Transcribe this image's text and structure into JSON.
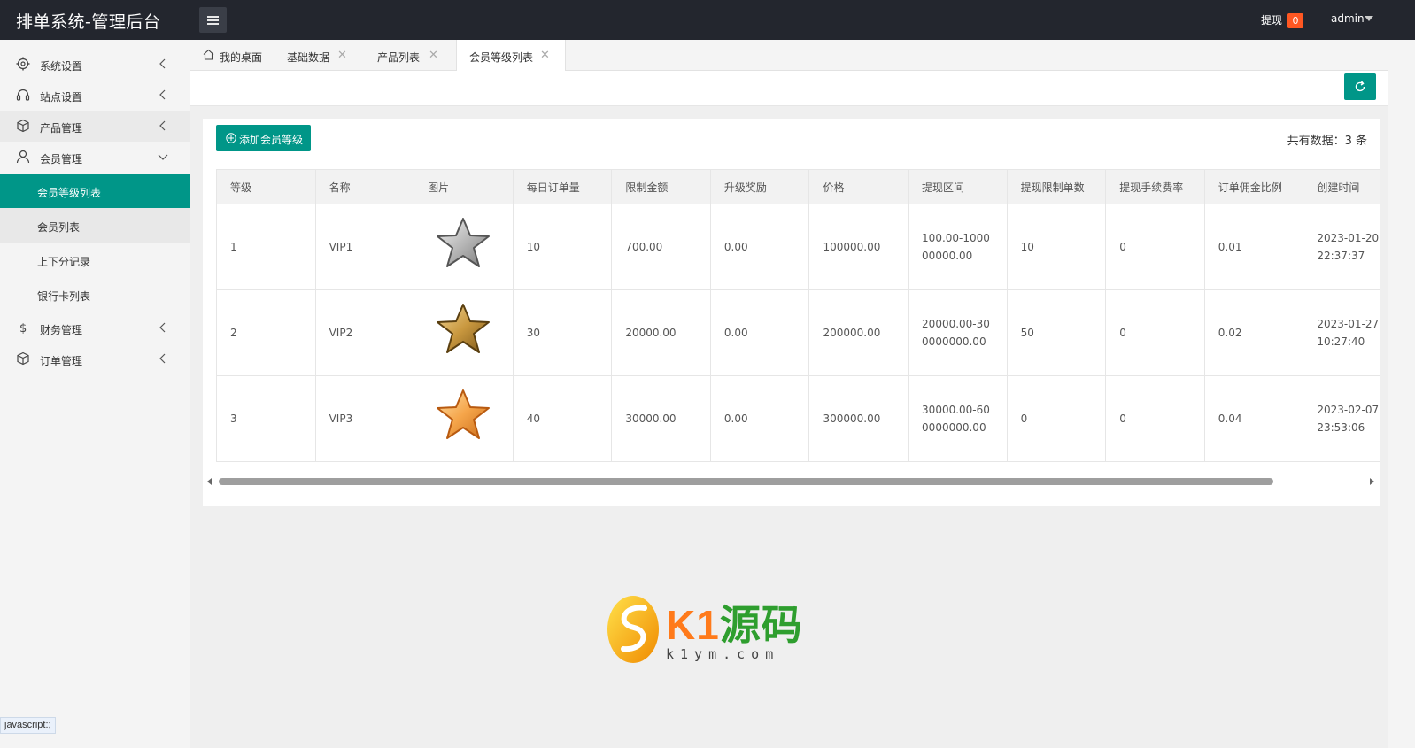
{
  "app": {
    "title": "排单系统-管理后台"
  },
  "header": {
    "withdraw_label": "提现",
    "withdraw_count": "0",
    "user": "admin"
  },
  "sidebar": {
    "groups": [
      {
        "label": "系统设置",
        "icon": "gear-icon"
      },
      {
        "label": "站点设置",
        "icon": "headset-icon"
      },
      {
        "label": "产品管理",
        "icon": "cube-icon"
      },
      {
        "label": "会员管理",
        "icon": "user-icon"
      },
      {
        "label": "财务管理",
        "icon": "dollar-icon"
      },
      {
        "label": "订单管理",
        "icon": "cube-icon"
      }
    ],
    "sub_items": [
      "会员等级列表",
      "会员列表",
      "上下分记录",
      "银行卡列表"
    ]
  },
  "tabs": [
    {
      "label": "我的桌面"
    },
    {
      "label": "基础数据"
    },
    {
      "label": "产品列表"
    },
    {
      "label": "会员等级列表"
    }
  ],
  "toolbar": {
    "add_label": "添加会员等级",
    "total_label": "共有数据：3 条"
  },
  "table": {
    "headers": [
      "等级",
      "名称",
      "图片",
      "每日订单量",
      "限制金额",
      "升级奖励",
      "价格",
      "提现区间",
      "提现限制单数",
      "提现手续费率",
      "订单佣金比例",
      "创建时间"
    ],
    "rows": [
      {
        "level": "1",
        "name": "VIP1",
        "star": "silver-star",
        "daily_orders": "10",
        "limit_amount": "700.00",
        "upgrade_reward": "0.00",
        "price": "100000.00",
        "withdraw_range": "100.00-100000000.00",
        "withdraw_limit": "10",
        "fee_rate": "0",
        "commission": "0.01",
        "created": "2023-01-20 22:37:37"
      },
      {
        "level": "2",
        "name": "VIP2",
        "star": "gold-star",
        "daily_orders": "30",
        "limit_amount": "20000.00",
        "upgrade_reward": "0.00",
        "price": "200000.00",
        "withdraw_range": "20000.00-300000000.00",
        "withdraw_limit": "50",
        "fee_rate": "0",
        "commission": "0.02",
        "created": "2023-01-27 10:27:40"
      },
      {
        "level": "3",
        "name": "VIP3",
        "star": "orange-star",
        "daily_orders": "40",
        "limit_amount": "30000.00",
        "upgrade_reward": "0.00",
        "price": "300000.00",
        "withdraw_range": "30000.00-600000000.00",
        "withdraw_limit": "0",
        "fee_rate": "0",
        "commission": "0.04",
        "created": "2023-02-07 23:53:06"
      }
    ]
  },
  "watermark": {
    "brand_k1": "K1",
    "brand_cn": "源码",
    "url": "k1ym.com"
  },
  "statusbar": "javascript:;",
  "colors": {
    "accent": "#009688",
    "topbar": "#23262e",
    "badge": "#ff5722"
  }
}
